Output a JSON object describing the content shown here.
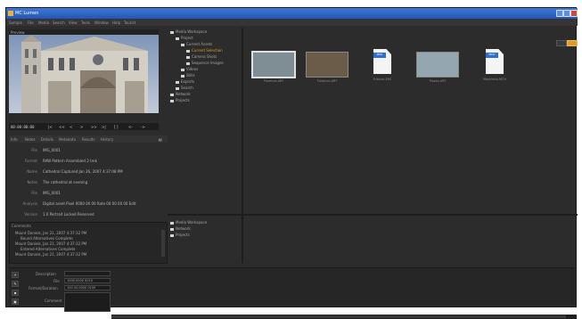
{
  "window": {
    "title": "MC Lumen"
  },
  "menubar": {
    "items": [
      "Sample",
      "File",
      "Media",
      "Search",
      "View",
      "Tools",
      "Window",
      "Help",
      "Tourist"
    ]
  },
  "preview": {
    "title": "Preview",
    "timecode": "00:00:00:00",
    "buttons": [
      "|<",
      "<<",
      "<",
      ">",
      ">>",
      ">|",
      "[ ]",
      "<-",
      "->"
    ]
  },
  "info_tabs": [
    "Info",
    "Notes",
    "Details",
    "Metadata",
    "Results",
    "History"
  ],
  "metadata": [
    {
      "label": "File",
      "value": "IMG_0001"
    },
    {
      "label": "Format",
      "value": "RAW        Pattern          Assembled  2 trek"
    },
    {
      "label": "Name",
      "value": "Cathedral              Captured  Jan 26, 2007 4:37:08 PM"
    },
    {
      "label": "Notes",
      "value": "The cathedral at evening"
    },
    {
      "label": "File",
      "value": "IMG_0001"
    },
    {
      "label": "Analysis",
      "value": "Digital asset  Pixel  0000 00 00   Rate  00 00 00 00     Edit"
    },
    {
      "label": "Version",
      "value": "1.0      Portrait   Locked   Reserved"
    }
  ],
  "comments": {
    "title": "Comments",
    "lines": [
      "Mount Daniels, Jan 21, 2007 4:37:32 PM",
      "Bound Alternatives Complete",
      "Mount Daniels, Jan 21, 2007 4:37:32 PM",
      "Entered Alternatives Complete",
      "Mount Daniels, Jan 21, 2007 4:37:32 PM"
    ]
  },
  "tree": {
    "items": [
      {
        "label": "Media Workspace",
        "indent": 0
      },
      {
        "label": "Project",
        "indent": 1
      },
      {
        "label": "Current Assets",
        "indent": 2
      },
      {
        "label": "Current Selection",
        "indent": 3,
        "selected": true
      },
      {
        "label": "Camera Shots",
        "indent": 3
      },
      {
        "label": "Sequence Images",
        "indent": 3
      },
      {
        "label": "Videos",
        "indent": 2
      },
      {
        "label": "Stills",
        "indent": 2
      },
      {
        "label": "Exports",
        "indent": 1
      },
      {
        "label": "Search",
        "indent": 1
      },
      {
        "label": "Network",
        "indent": 0
      },
      {
        "label": "Projects",
        "indent": 0
      }
    ]
  },
  "tree2": {
    "items": [
      {
        "label": "Media Workspace"
      },
      {
        "label": "Network"
      },
      {
        "label": "Projects"
      }
    ]
  },
  "thumbnails": [
    {
      "caption": "Florence.ART",
      "kind": "image",
      "color": "#7f8d94"
    },
    {
      "caption": "Florence.ART",
      "kind": "image",
      "color": "#6a5c48"
    },
    {
      "caption": "Tribune.EXE",
      "kind": "doc",
      "badge": "MPG"
    },
    {
      "caption": "Piazza.ART",
      "kind": "image",
      "color": "#94a7b0"
    },
    {
      "caption": "Manifesto.MOV",
      "kind": "doc",
      "badge": "MOV"
    }
  ],
  "bottom": {
    "fields": [
      {
        "label": "Description"
      },
      {
        "label": "File"
      },
      {
        "label": "Format/Duration"
      },
      {
        "label": "Comment"
      }
    ],
    "field_values": [
      "",
      "1000.0000 0010",
      "100 00.0000 0100",
      ""
    ]
  },
  "colors": {
    "accent": "#e09a2a",
    "titlebar": "#2f62c2"
  }
}
